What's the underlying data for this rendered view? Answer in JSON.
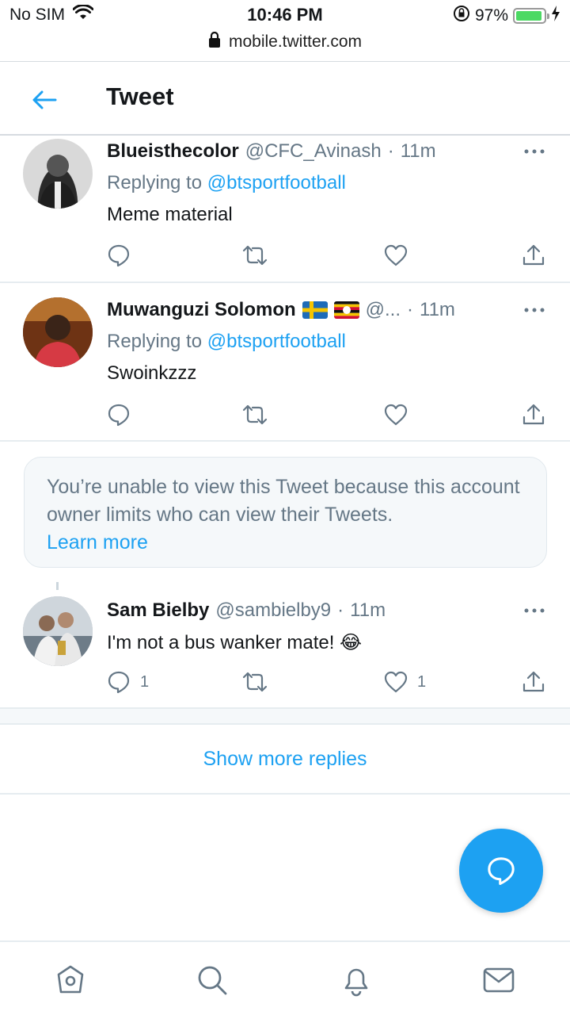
{
  "status_bar": {
    "carrier": "No SIM",
    "time": "10:46 PM",
    "battery": "97%",
    "url": "mobile.twitter.com"
  },
  "header": {
    "title": "Tweet"
  },
  "tweets": [
    {
      "name": "Blueisthecolor",
      "handle": "@CFC_Avinash",
      "time": "11m",
      "replying_prefix": "Replying to",
      "replying_to": "@btsportfootball",
      "text": "Meme material"
    },
    {
      "name": "Muwanguzi Solomon",
      "handle": "@...",
      "time": "11m",
      "replying_prefix": "Replying to",
      "replying_to": "@btsportfootball",
      "text": "Swoinkzzz"
    },
    {
      "name": "Sam Bielby",
      "handle": "@sambielby9",
      "time": "11m",
      "text": "I'm not a bus wanker mate! 😂",
      "reply_count": "1",
      "like_count": "1"
    }
  ],
  "notice": {
    "text": "You’re unable to view this Tweet because this account owner limits who can view their Tweets.",
    "link": "Learn more"
  },
  "show_more": "Show more replies",
  "separator": "·",
  "colors": {
    "accent": "#1da1f2",
    "secondary_text": "#657786",
    "primary_text": "#14171a"
  }
}
